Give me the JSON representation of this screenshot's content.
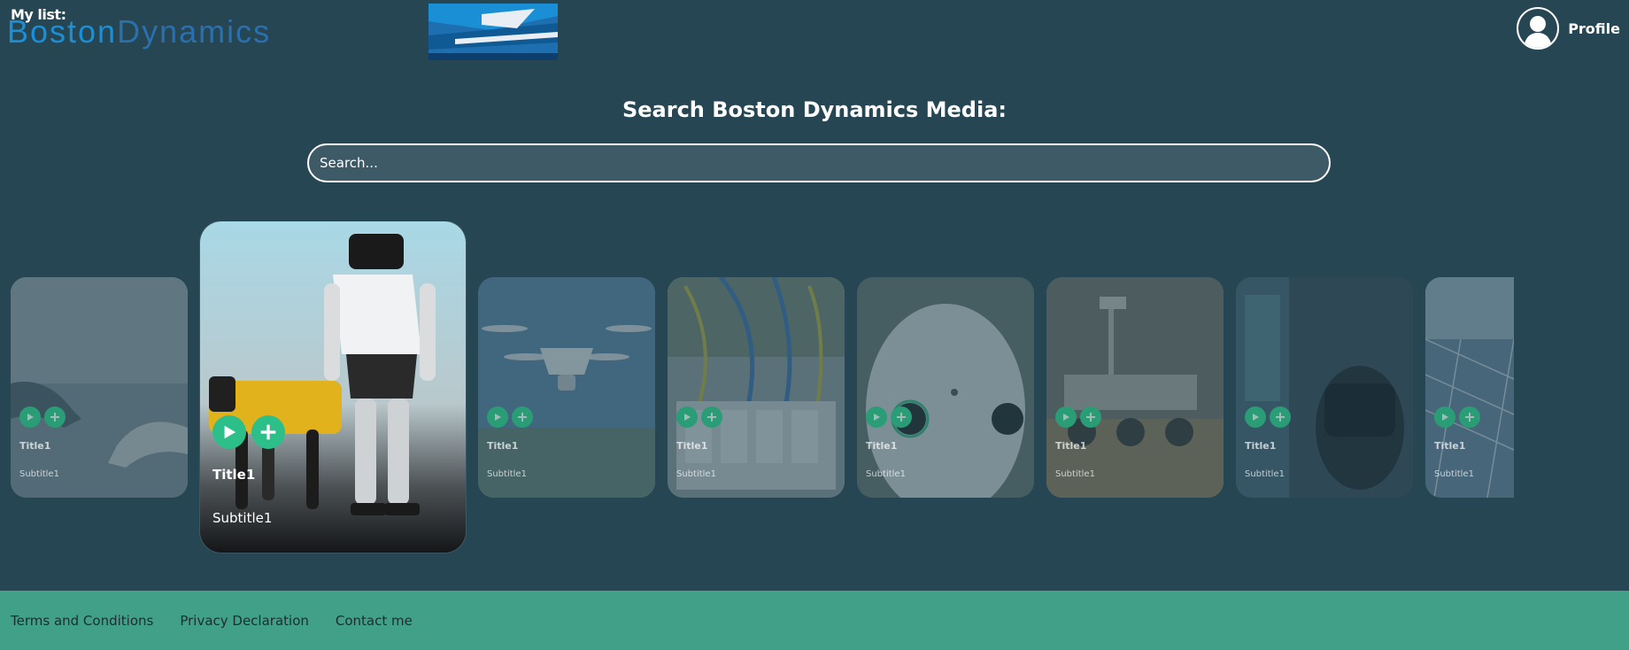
{
  "header": {
    "my_list_label": "My list:",
    "logo_text_part1": "Boston",
    "logo_text_part2": "Dynamics",
    "profile_label": "Profile"
  },
  "search": {
    "title": "Search Boston Dynamics Media:",
    "placeholder": "Search..."
  },
  "featured": {
    "title": "Title1",
    "subtitle": "Subtitle1"
  },
  "cards": [
    {
      "title": "Title1",
      "subtitle": "Subtitle1",
      "image": "robotic-hand"
    },
    {
      "title": "Title1",
      "subtitle": "Subtitle1",
      "image": "drone"
    },
    {
      "title": "Title1",
      "subtitle": "Subtitle1",
      "image": "server-cables"
    },
    {
      "title": "Title1",
      "subtitle": "Subtitle1",
      "image": "humanoid-robot-face"
    },
    {
      "title": "Title1",
      "subtitle": "Subtitle1",
      "image": "mars-rover"
    },
    {
      "title": "Title1",
      "subtitle": "Subtitle1",
      "image": "vr-headset"
    },
    {
      "title": "Title1",
      "subtitle": "Subtitle1",
      "image": "solar-panels"
    }
  ],
  "footer": {
    "terms": "Terms and Conditions",
    "privacy": "Privacy Declaration",
    "contact": "Contact me"
  },
  "colors": {
    "background": "#264653",
    "footer": "#40a088",
    "accent": "#2dbf8a"
  }
}
